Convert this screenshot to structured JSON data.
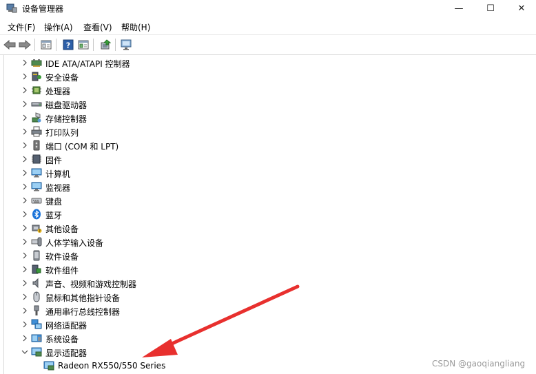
{
  "window": {
    "title": "设备管理器",
    "minimize_glyph": "—",
    "maximize_glyph": "☐",
    "close_glyph": "✕"
  },
  "menu": [
    {
      "label": "文件(F)"
    },
    {
      "label": "操作(A)"
    },
    {
      "label": "查看(V)"
    },
    {
      "label": "帮助(H)"
    }
  ],
  "toolbar": [
    {
      "icon": "back-arrow-icon"
    },
    {
      "icon": "forward-arrow-icon"
    },
    {
      "icon": "properties-icon"
    },
    {
      "icon": "help-icon"
    },
    {
      "icon": "view-icon"
    },
    {
      "icon": "update-driver-icon"
    },
    {
      "icon": "scan-hardware-icon"
    }
  ],
  "tree": [
    {
      "label": "IDE ATA/ATAPI 控制器",
      "icon": "ide-controller-icon",
      "expanded": false
    },
    {
      "label": "安全设备",
      "icon": "security-device-icon",
      "expanded": false
    },
    {
      "label": "处理器",
      "icon": "processor-icon",
      "expanded": false
    },
    {
      "label": "磁盘驱动器",
      "icon": "disk-drive-icon",
      "expanded": false
    },
    {
      "label": "存储控制器",
      "icon": "storage-controller-icon",
      "expanded": false
    },
    {
      "label": "打印队列",
      "icon": "printer-icon",
      "expanded": false
    },
    {
      "label": "端口 (COM 和 LPT)",
      "icon": "port-icon",
      "expanded": false
    },
    {
      "label": "固件",
      "icon": "firmware-icon",
      "expanded": false
    },
    {
      "label": "计算机",
      "icon": "computer-icon",
      "expanded": false
    },
    {
      "label": "监视器",
      "icon": "monitor-icon",
      "expanded": false
    },
    {
      "label": "键盘",
      "icon": "keyboard-icon",
      "expanded": false
    },
    {
      "label": "蓝牙",
      "icon": "bluetooth-icon",
      "expanded": false
    },
    {
      "label": "其他设备",
      "icon": "other-devices-icon",
      "expanded": false
    },
    {
      "label": "人体学输入设备",
      "icon": "hid-icon",
      "expanded": false
    },
    {
      "label": "软件设备",
      "icon": "software-device-icon",
      "expanded": false
    },
    {
      "label": "软件组件",
      "icon": "software-component-icon",
      "expanded": false
    },
    {
      "label": "声音、视频和游戏控制器",
      "icon": "audio-icon",
      "expanded": false
    },
    {
      "label": "鼠标和其他指针设备",
      "icon": "mouse-icon",
      "expanded": false
    },
    {
      "label": "通用串行总线控制器",
      "icon": "usb-icon",
      "expanded": false
    },
    {
      "label": "网络适配器",
      "icon": "network-adapter-icon",
      "expanded": false
    },
    {
      "label": "系统设备",
      "icon": "system-device-icon",
      "expanded": false
    },
    {
      "label": "显示适配器",
      "icon": "display-adapter-icon",
      "expanded": true
    },
    {
      "label": "Radeon RX550/550 Series",
      "icon": "display-adapter-icon",
      "child": true
    }
  ],
  "watermark": "CSDN @gaoqiangliang",
  "colors": {
    "annotation_arrow": "#e8302e"
  }
}
